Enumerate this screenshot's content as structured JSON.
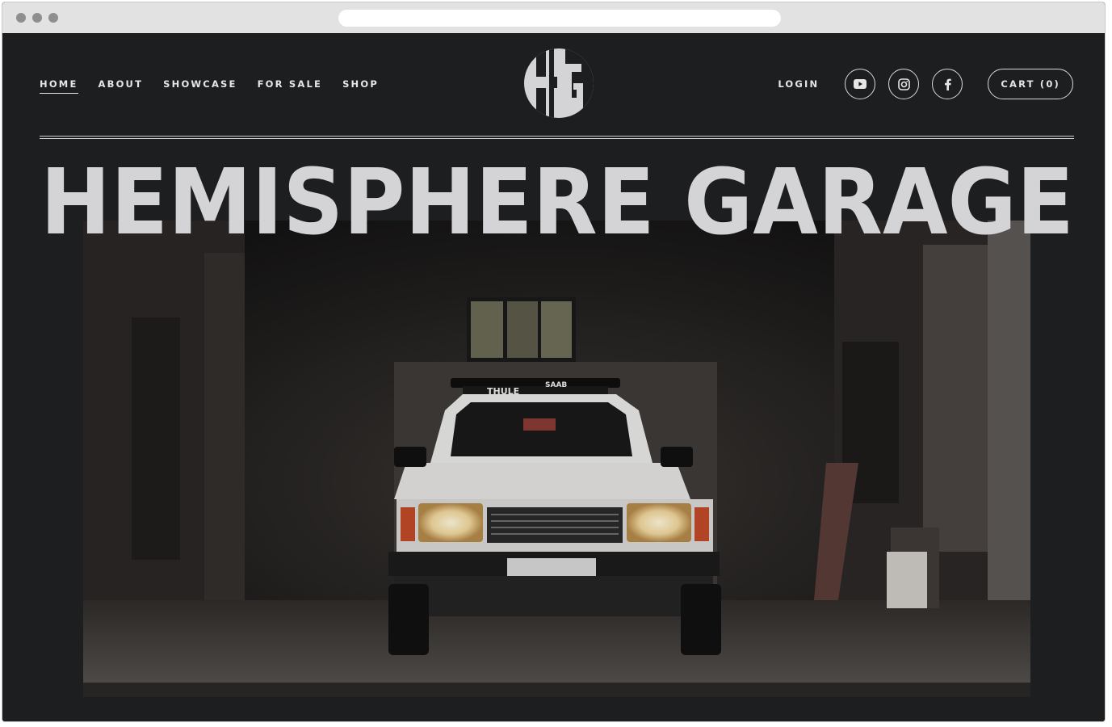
{
  "nav": {
    "items": [
      "HOME",
      "ABOUT",
      "SHOWCASE",
      "FOR SALE",
      "SHOP"
    ],
    "active": "HOME"
  },
  "logo": {
    "letters": "HG"
  },
  "header_right": {
    "login_label": "LOGIN",
    "social": [
      {
        "name": "youtube-icon"
      },
      {
        "name": "instagram-icon"
      },
      {
        "name": "facebook-icon"
      }
    ],
    "cart_label": "CART (0)"
  },
  "hero": {
    "title": "HEMISPHERE GARAGE",
    "photo_text": {
      "roof_rack": "THULE",
      "brand_badge": "SAAB"
    }
  },
  "colors": {
    "page_bg": "#1d1e20",
    "text": "#e6e6e6",
    "title": "#d4d4d6"
  }
}
